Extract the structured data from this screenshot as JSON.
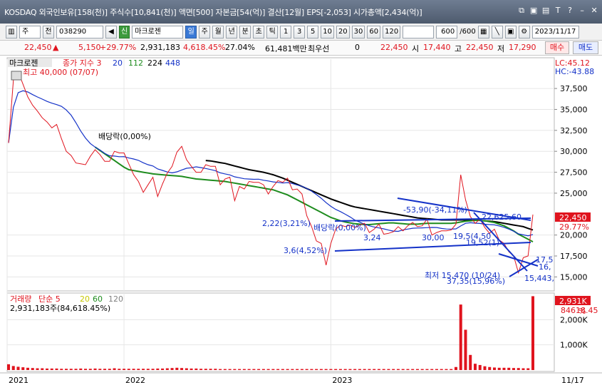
{
  "title_bar": {
    "text": "KOSDAQ 외국인보유[158(천)] 주식수[10,841(천)] 액면[500] 자본금[54(억)] 결산[12월] EPS[-2,053] 시가총액[2,434(억)]",
    "icons": [
      "window-restore-icon",
      "save-icon",
      "lock-icon",
      "text-icon",
      "question-icon",
      "minimize-icon",
      "close-icon"
    ]
  },
  "toolbar": {
    "type_select": "주",
    "prev_label": "전",
    "code": "038290",
    "stock_badge": "신",
    "stock_name": "마크로젠",
    "periods": [
      "일",
      "주",
      "월",
      "년",
      "분",
      "초",
      "틱"
    ],
    "selected_period": "일",
    "intervals": [
      "1",
      "3",
      "5",
      "10",
      "20",
      "30",
      "60",
      "120"
    ],
    "count": "600",
    "total": "/600",
    "date": "2023/11/17"
  },
  "quote": {
    "price": "22,450",
    "change": "5,150",
    "change_pct": "+29.77%",
    "volume": "2,931,183",
    "volume_pct": "4,618.45%",
    "turnover": "27.04%",
    "amount": "61,481백만",
    "priority_label": "최우선",
    "priority_value": "0",
    "ask": "22,450",
    "open_label": "시",
    "open": "17,440",
    "high_label": "고",
    "high": "22,450",
    "low_label": "저",
    "low": "17,290",
    "buy_label": "매수",
    "sell_label": "매도"
  },
  "chart_data": {
    "type": "line",
    "price_panel": {
      "name_label": "마크로젠",
      "ma_label": "종가 지수 3",
      "ma_periods": [
        "20",
        "112",
        "224",
        "448"
      ],
      "ma_colors": [
        "#1432c8",
        "#1e8c1e",
        "#000000",
        "#6a5acd"
      ],
      "lc_label": "LC:45.12",
      "hc_label": "HC:-43.88",
      "ylim": [
        13500,
        41000
      ],
      "ticks": [
        37500,
        35000,
        32500,
        30000,
        27500,
        25000,
        20000,
        17500,
        15000
      ],
      "tick_labels": [
        "37,500",
        "35,000",
        "32,500",
        "30,000",
        "27,500",
        "25,000",
        "20,000",
        "17,500",
        "15,000"
      ],
      "current_price_label": "22,450",
      "current_pct_label": "29.77%",
      "x_labels": [
        "2021",
        "2022",
        "2023"
      ],
      "annotations": {
        "high": "최고 40,000 (07/07)",
        "ex_div": "배당락(0,00%)",
        "low": "최저 15,470 (10/24)",
        "a1": "-53,90(-34,11%)",
        "a2": "22,625,60",
        "a3": "2,22(3,21%)",
        "a4": "배당락(0,00%)",
        "a5": "3,24",
        "a6": "30,00",
        "a7": "19,5(4,50",
        "a8": "19,52(1)",
        "a9": "3,6(4,52%)",
        "a10": "37,35(15,96%)",
        "a11": "15,443,",
        "a12": "17,5",
        "a13": "16,"
      },
      "close": [
        31000,
        38500,
        39500,
        38000,
        36500,
        35500,
        34800,
        34000,
        33500,
        32800,
        33200,
        31500,
        30000,
        29500,
        28600,
        28500,
        28400,
        29400,
        30200,
        29600,
        28800,
        28800,
        30000,
        29800,
        29800,
        28500,
        27200,
        26400,
        25100,
        26000,
        26900,
        24600,
        26100,
        27400,
        28200,
        29900,
        30600,
        29000,
        28200,
        27500,
        27500,
        28400,
        28200,
        28200,
        26000,
        26700,
        26900,
        24100,
        25800,
        25500,
        26400,
        26300,
        26300,
        26000,
        24900,
        25800,
        26500,
        26300,
        26800,
        25400,
        25500,
        24900,
        22300,
        21000,
        19300,
        19000,
        16400,
        19000,
        20700,
        21200,
        21000,
        21200,
        20900,
        21200,
        21400,
        20300,
        20700,
        21300,
        20100,
        20200,
        20400,
        21000,
        20500,
        21100,
        21500,
        21000,
        21100,
        21900,
        20000,
        20300,
        20500,
        20500,
        20600,
        21300,
        27200,
        24200,
        22200,
        21400,
        21900,
        20900,
        20200,
        20700,
        19400,
        19000,
        18000,
        17500,
        15500,
        17300,
        17500,
        22450
      ],
      "ma20": [
        31000,
        35250,
        37000,
        37230,
        37080,
        36770,
        36490,
        36230,
        35960,
        35750,
        35580,
        35360,
        34940,
        34320,
        33420,
        32420,
        31580,
        30930,
        30500,
        30150,
        29750,
        29460,
        29430,
        29350,
        29360,
        29200,
        29080,
        28920,
        28630,
        28400,
        28250,
        27890,
        27720,
        27530,
        27420,
        27550,
        27770,
        27970,
        28030,
        28140,
        28050,
        27950,
        27820,
        27680,
        27430,
        27300,
        27180,
        26950,
        26840,
        26720,
        26690,
        26650,
        26670,
        26540,
        26460,
        26350,
        26290,
        26210,
        26260,
        26150,
        25980,
        25820,
        25560,
        25240,
        24830,
        24390,
        23870,
        23430,
        23060,
        22800,
        22480,
        22160,
        21780,
        21540,
        21290,
        21100,
        20960,
        20850,
        20740,
        20590,
        20470,
        20440,
        20620,
        20710,
        20810,
        20840,
        20860,
        20880,
        20910,
        20900,
        20790,
        20720,
        20710,
        20740,
        21090,
        21400,
        21470,
        21420,
        21380,
        21290,
        21250,
        21210,
        21090,
        20920,
        20710,
        20460,
        20140,
        20020,
        19910,
        20060
      ],
      "ma112": [
        null,
        null,
        null,
        null,
        null,
        null,
        null,
        null,
        null,
        null,
        null,
        null,
        null,
        null,
        null,
        null,
        null,
        null,
        30500,
        30100,
        29700,
        29300,
        28900,
        28500,
        28100,
        27800,
        27700,
        27600,
        27500,
        27400,
        27300,
        27250,
        27200,
        27150,
        27100,
        27050,
        27000,
        26900,
        26800,
        26700,
        26650,
        26600,
        26550,
        26500,
        26450,
        26400,
        26300,
        26200,
        26100,
        26000,
        25900,
        25800,
        25700,
        25600,
        25500,
        25400,
        25200,
        25000,
        24800,
        24500,
        24200,
        23900,
        23600,
        23300,
        23000,
        22700,
        22400,
        22100,
        21900,
        21700,
        21550,
        21450,
        21350,
        21300,
        21250,
        21250,
        21300,
        21350,
        21400,
        21450,
        21450,
        21400,
        21350,
        21300,
        21300,
        21300,
        21350,
        21400,
        21400,
        21400,
        21400,
        21400,
        21400,
        21450,
        21550,
        21650,
        21700,
        21750,
        21750,
        21700,
        21600,
        21500,
        21300,
        21100,
        20800,
        20500,
        20100,
        19800,
        19500,
        19200
      ],
      "ma224": [
        null,
        null,
        null,
        null,
        null,
        null,
        null,
        null,
        null,
        null,
        null,
        null,
        null,
        null,
        null,
        null,
        null,
        null,
        null,
        null,
        null,
        null,
        null,
        null,
        null,
        null,
        null,
        null,
        null,
        null,
        null,
        null,
        null,
        null,
        null,
        null,
        null,
        null,
        null,
        null,
        null,
        28900,
        28850,
        28750,
        28650,
        28550,
        28400,
        28250,
        28100,
        27950,
        27800,
        27700,
        27600,
        27500,
        27350,
        27200,
        27000,
        26800,
        26550,
        26300,
        26050,
        25800,
        25550,
        25300,
        25050,
        24800,
        24550,
        24300,
        24100,
        23900,
        23700,
        23500,
        23350,
        23250,
        23150,
        23050,
        22950,
        22850,
        22750,
        22650,
        22550,
        22450,
        22350,
        22250,
        22150,
        22050,
        22000,
        21950,
        21900,
        21850,
        21800,
        21800,
        21800,
        21800,
        21800,
        21800,
        21800,
        21800,
        21750,
        21700,
        21650,
        21600,
        21500,
        21400,
        21300,
        21200,
        21100,
        21000,
        20800,
        20600
      ]
    },
    "volume_panel": {
      "title": "거래량",
      "ma_label": "단순 5",
      "ma_periods": [
        "20",
        "60",
        "120"
      ],
      "ma_colors": [
        "#c8c800",
        "#1e8c1e",
        "#808080"
      ],
      "value_label": "2,931,183주(84,618.45%)",
      "ylim": [
        0,
        3000000
      ],
      "ticks": [
        2000000,
        1000000
      ],
      "tick_labels": [
        "2,000K",
        "1,000K"
      ],
      "current_label": "2,931K",
      "current_pct_label": "84618.45",
      "volume": [
        230000,
        160000,
        130000,
        110000,
        90000,
        80000,
        70000,
        70000,
        60000,
        60000,
        60000,
        50000,
        50000,
        50000,
        50000,
        60000,
        50000,
        50000,
        60000,
        50000,
        50000,
        50000,
        70000,
        50000,
        50000,
        50000,
        50000,
        50000,
        50000,
        50000,
        50000,
        60000,
        60000,
        70000,
        80000,
        90000,
        80000,
        70000,
        60000,
        60000,
        50000,
        50000,
        50000,
        50000,
        40000,
        40000,
        40000,
        40000,
        40000,
        40000,
        40000,
        40000,
        40000,
        40000,
        40000,
        40000,
        40000,
        40000,
        40000,
        40000,
        40000,
        40000,
        40000,
        40000,
        40000,
        40000,
        40000,
        40000,
        40000,
        40000,
        40000,
        40000,
        40000,
        40000,
        40000,
        40000,
        40000,
        40000,
        40000,
        40000,
        40000,
        40000,
        40000,
        40000,
        40000,
        40000,
        40000,
        40000,
        40000,
        40000,
        40000,
        40000,
        40000,
        120000,
        2600000,
        1600000,
        600000,
        250000,
        200000,
        150000,
        120000,
        100000,
        90000,
        90000,
        90000,
        80000,
        80000,
        70000,
        70000,
        2931183
      ],
      "date_label": "11/17"
    }
  }
}
